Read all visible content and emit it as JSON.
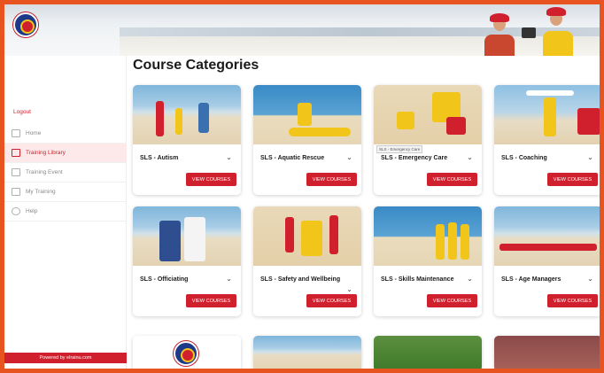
{
  "sidebar": {
    "logout": "Logout",
    "items": [
      {
        "label": "Home",
        "icon": "home-icon",
        "active": false
      },
      {
        "label": "Training Library",
        "icon": "library-icon",
        "active": true
      },
      {
        "label": "Training Event",
        "icon": "calendar-icon",
        "active": false
      },
      {
        "label": "My Training",
        "icon": "document-icon",
        "active": false
      },
      {
        "label": "Help",
        "icon": "help-icon",
        "active": false
      }
    ],
    "powered": "Powered by elrainu.com"
  },
  "main": {
    "title": "Course Categories",
    "button_label": "VIEW COURSES",
    "tooltip": "SLS - Emergency Care",
    "cards": [
      {
        "label": "SLS - Autism"
      },
      {
        "label": "SLS - Aquatic Rescue"
      },
      {
        "label": "SLS - Emergency Care"
      },
      {
        "label": "SLS - Coaching"
      },
      {
        "label": "SLS - Officiating"
      },
      {
        "label": "SLS - Safety and Wellbeing"
      },
      {
        "label": "SLS - Skills Maintenance"
      },
      {
        "label": "SLS - Age Managers"
      }
    ]
  },
  "colors": {
    "frame": "#e8541f",
    "accent_red": "#d0202e",
    "patrol_yellow": "#f2c51a",
    "active_bg": "#fde9ea"
  }
}
